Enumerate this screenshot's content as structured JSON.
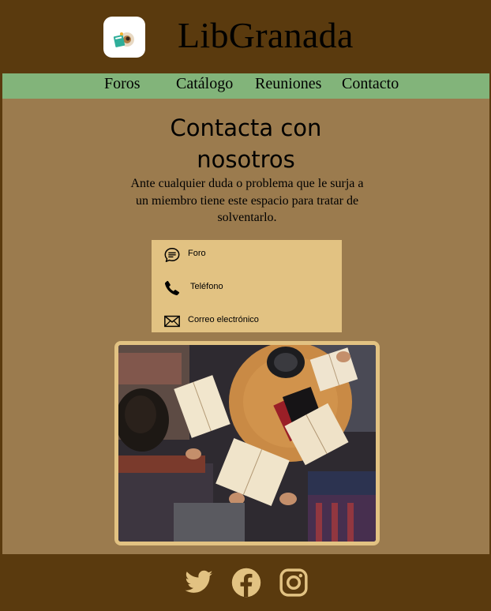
{
  "header": {
    "brand": "LibGranada",
    "logo_icon": "book-reader-icon"
  },
  "nav": {
    "items": [
      "Foros",
      "Catálogo",
      "Reuniones",
      "Contacto"
    ]
  },
  "main": {
    "title_line1": "Contacta con",
    "title_line2": "nosotros",
    "intro": "Ante cualquier duda o problema que le surja a un miembro tiene este espacio para tratar de solventarlo."
  },
  "contact": {
    "items": [
      {
        "label": "Foro",
        "icon": "chat-bubble-icon"
      },
      {
        "label": "Teléfono",
        "icon": "phone-icon"
      },
      {
        "label": "Correo electrónico",
        "icon": "mail-icon"
      }
    ]
  },
  "footer": {
    "icons": [
      "twitter-icon",
      "facebook-icon",
      "instagram-icon"
    ]
  },
  "colors": {
    "header_bg": "#5a3a0e",
    "nav_bg": "#82b47a",
    "body_bg": "#9b7b4e",
    "contact_bg": "#e2c282",
    "icon_color": "#e2c282"
  }
}
